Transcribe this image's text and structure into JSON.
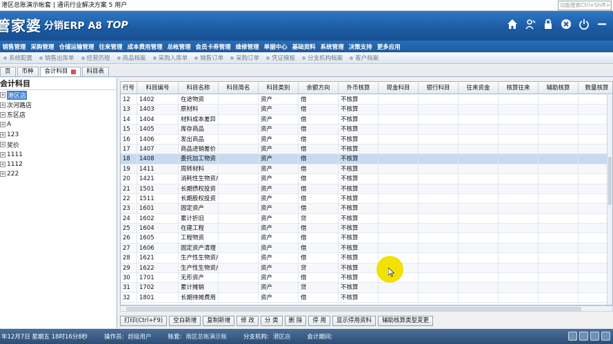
{
  "window": {
    "title": "港区总账演示帐套 | 通讯行业解决方案 5 用户"
  },
  "brand": {
    "main": "管家婆",
    "sub": "分销ERP A8",
    "edition": "TOP"
  },
  "banner_icons": [
    "home-icon",
    "user-icon",
    "lock-icon",
    "close-circle-icon",
    "power-icon",
    "minimize-icon"
  ],
  "menu": [
    "销售管理",
    "采购管理",
    "仓储运输管理",
    "往来管理",
    "成本费用管理",
    "总帐管理",
    "会员卡券管理",
    "维修管理",
    "单据中心",
    "基础资料",
    "系统管理",
    "决策支持",
    "更多应用"
  ],
  "search_placeholder": "功能搜索Ctrl+Shift+F",
  "quickbar": [
    "系统配置",
    "销售出库单",
    "经营历程",
    "商品档案",
    "采购入库单",
    "销售订单",
    "采购订单",
    "凭证模板",
    "分支机构档案",
    "客户档案"
  ],
  "tabs": [
    {
      "label": "页"
    },
    {
      "label": "币种"
    },
    {
      "label": "会计科目",
      "active": true
    },
    {
      "label": "科目表"
    }
  ],
  "tree": {
    "title": "会计科目",
    "nodes": [
      {
        "label": "港区店",
        "selected": true
      },
      {
        "label": "次河路店"
      },
      {
        "label": "东区店"
      },
      {
        "label": "A"
      },
      {
        "label": "123"
      },
      {
        "label": "奖价"
      },
      {
        "label": "1111"
      },
      {
        "label": "1112"
      },
      {
        "label": "222"
      }
    ]
  },
  "grid": {
    "columns": [
      "行号",
      "科目编号",
      "科目名称",
      "科目简名",
      "科目类别",
      "余额方向",
      "外币核算",
      "现金科目",
      "银行科目",
      "往来资金",
      "核算往来",
      "辅助核算",
      "数量核算"
    ],
    "rows": [
      [
        "12",
        "1402",
        "在途物资",
        "",
        "资产",
        "借",
        "不核算"
      ],
      [
        "13",
        "1403",
        "原材料",
        "",
        "资产",
        "借",
        "不核算"
      ],
      [
        "14",
        "1404",
        "材料成本差异",
        "",
        "资产",
        "借",
        "不核算"
      ],
      [
        "15",
        "1405",
        "库存商品",
        "",
        "资产",
        "借",
        "不核算"
      ],
      [
        "16",
        "1406",
        "发出商品",
        "",
        "资产",
        "借",
        "不核算"
      ],
      [
        "17",
        "1407",
        "商品进销差价",
        "",
        "资产",
        "借",
        "不核算"
      ],
      [
        "18",
        "1408",
        "委托加工物资",
        "",
        "资产",
        "借",
        "不核算"
      ],
      [
        "19",
        "1411",
        "周转材料",
        "",
        "资产",
        "借",
        "不核算"
      ],
      [
        "20",
        "1421",
        "消耗性生物资产",
        "",
        "资产",
        "借",
        "不核算"
      ],
      [
        "21",
        "1501",
        "长期债权投资",
        "",
        "资产",
        "借",
        "不核算"
      ],
      [
        "22",
        "1511",
        "长期股权投资",
        "",
        "资产",
        "借",
        "不核算"
      ],
      [
        "23",
        "1601",
        "固定资产",
        "",
        "资产",
        "借",
        "不核算"
      ],
      [
        "24",
        "1602",
        "累计折旧",
        "",
        "资产",
        "贷",
        "不核算"
      ],
      [
        "25",
        "1604",
        "在建工程",
        "",
        "资产",
        "借",
        "不核算"
      ],
      [
        "26",
        "1605",
        "工程物资",
        "",
        "资产",
        "借",
        "不核算"
      ],
      [
        "27",
        "1606",
        "固定资产清理",
        "",
        "资产",
        "借",
        "不核算"
      ],
      [
        "28",
        "1621",
        "生产性生物资产",
        "",
        "资产",
        "借",
        "不核算"
      ],
      [
        "29",
        "1622",
        "生产性生物资产",
        "",
        "资产",
        "贷",
        "不核算"
      ],
      [
        "30",
        "1701",
        "无形资产",
        "",
        "资产",
        "借",
        "不核算"
      ],
      [
        "31",
        "1702",
        "累计摊销",
        "",
        "资产",
        "贷",
        "不核算"
      ],
      [
        "32",
        "1801",
        "长期待摊费用",
        "",
        "资产",
        "借",
        "不核算"
      ]
    ],
    "selected_row": 6
  },
  "buttons": [
    "打印(Ctrl+F9)",
    "空白新增",
    "复制新增",
    "修 改",
    "分 类",
    "删 除",
    "停 用",
    "显示停用资料",
    "辅助核算类型变更"
  ],
  "status": {
    "datetime": "年12月7日 星期五 18时16分8秒",
    "operator_label": "操作员:",
    "operator": "超级用户",
    "account_label": "账套:",
    "account": "南区总账演示账",
    "branch_label": "分支机构:",
    "branch": "港区店",
    "period_label": "会计期间:",
    "period": ""
  },
  "colors": {
    "banner": "#1b5aa3",
    "selected_row": "#c7daf1",
    "cursor_highlight": "#f2e200"
  }
}
